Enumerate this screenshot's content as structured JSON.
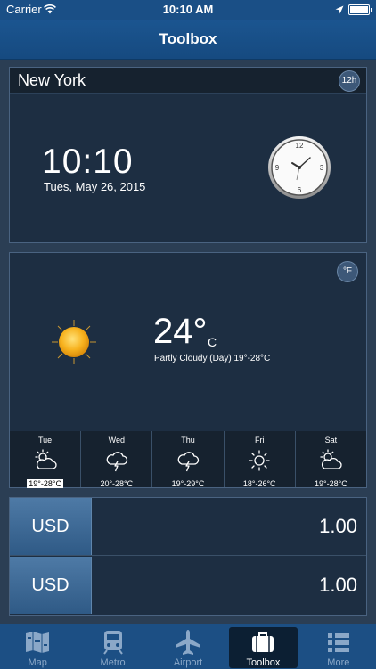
{
  "status_bar": {
    "carrier": "Carrier",
    "time": "10:10 AM",
    "battery_level": 1.0
  },
  "nav": {
    "title": "Toolbox"
  },
  "clock": {
    "city": "New York",
    "format_badge": "12h",
    "time": "10:10",
    "date": "Tues, May 26, 2015"
  },
  "weather": {
    "unit_badge": "°F",
    "temp": "24°",
    "unit": "C",
    "condition": "Partly Cloudy (Day) 19°-28°C",
    "forecast": [
      {
        "day": "Tue",
        "range": "19°-28°C",
        "icon": "partly-cloudy-icon"
      },
      {
        "day": "Wed",
        "range": "20°-28°C",
        "icon": "thunderstorm-icon"
      },
      {
        "day": "Thu",
        "range": "19°-29°C",
        "icon": "thunderstorm-icon"
      },
      {
        "day": "Fri",
        "range": "18°-26°C",
        "icon": "sun-icon"
      },
      {
        "day": "Sat",
        "range": "19°-28°C",
        "icon": "partly-cloudy-icon"
      }
    ]
  },
  "currency": [
    {
      "code": "USD",
      "amount": "1.00"
    },
    {
      "code": "USD",
      "amount": "1.00"
    }
  ],
  "tabs": [
    {
      "label": "Map",
      "icon": "map-icon"
    },
    {
      "label": "Metro",
      "icon": "metro-icon"
    },
    {
      "label": "Airport",
      "icon": "airplane-icon"
    },
    {
      "label": "Toolbox",
      "icon": "toolbox-icon",
      "active": true
    },
    {
      "label": "More",
      "icon": "more-list-icon"
    }
  ]
}
